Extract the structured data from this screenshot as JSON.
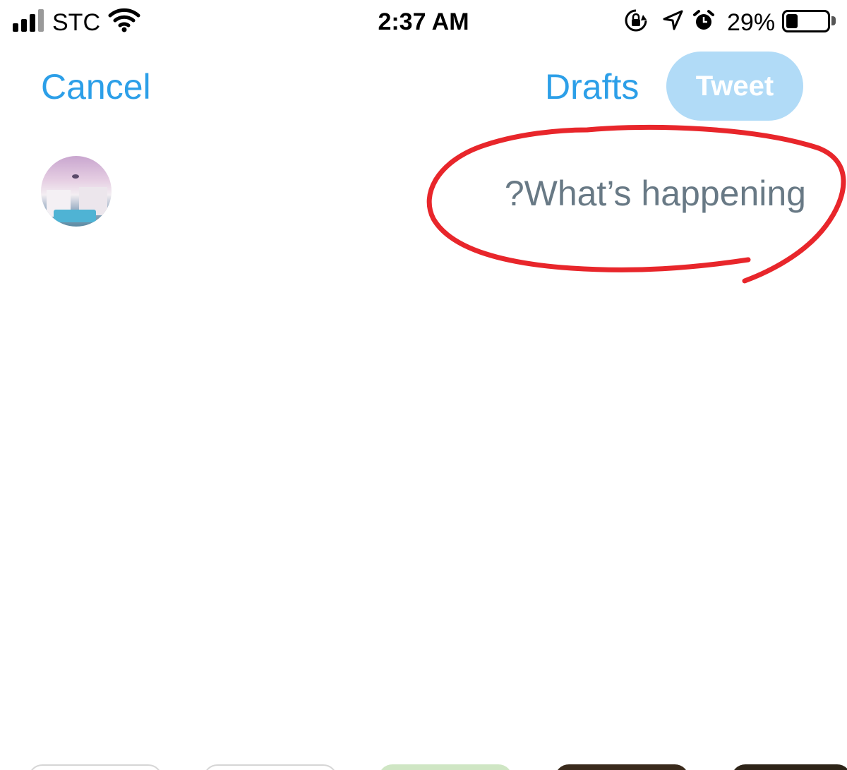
{
  "status_bar": {
    "carrier": "STC",
    "time": "2:37 AM",
    "battery_percent": "29%",
    "battery_level": 0.29,
    "icons": [
      "signal-bars-icon",
      "wifi-icon",
      "orientation-lock-icon",
      "location-arrow-icon",
      "alarm-clock-icon",
      "battery-icon"
    ]
  },
  "nav": {
    "cancel_label": "Cancel",
    "drafts_label": "Drafts",
    "tweet_label": "Tweet"
  },
  "compose": {
    "placeholder": "?What’s happening",
    "value": ""
  },
  "colors": {
    "accent": "#2c9fe8",
    "tweet_button_disabled": "#b1dbf7",
    "placeholder_text": "#687985",
    "annotation": "#e8262b"
  }
}
